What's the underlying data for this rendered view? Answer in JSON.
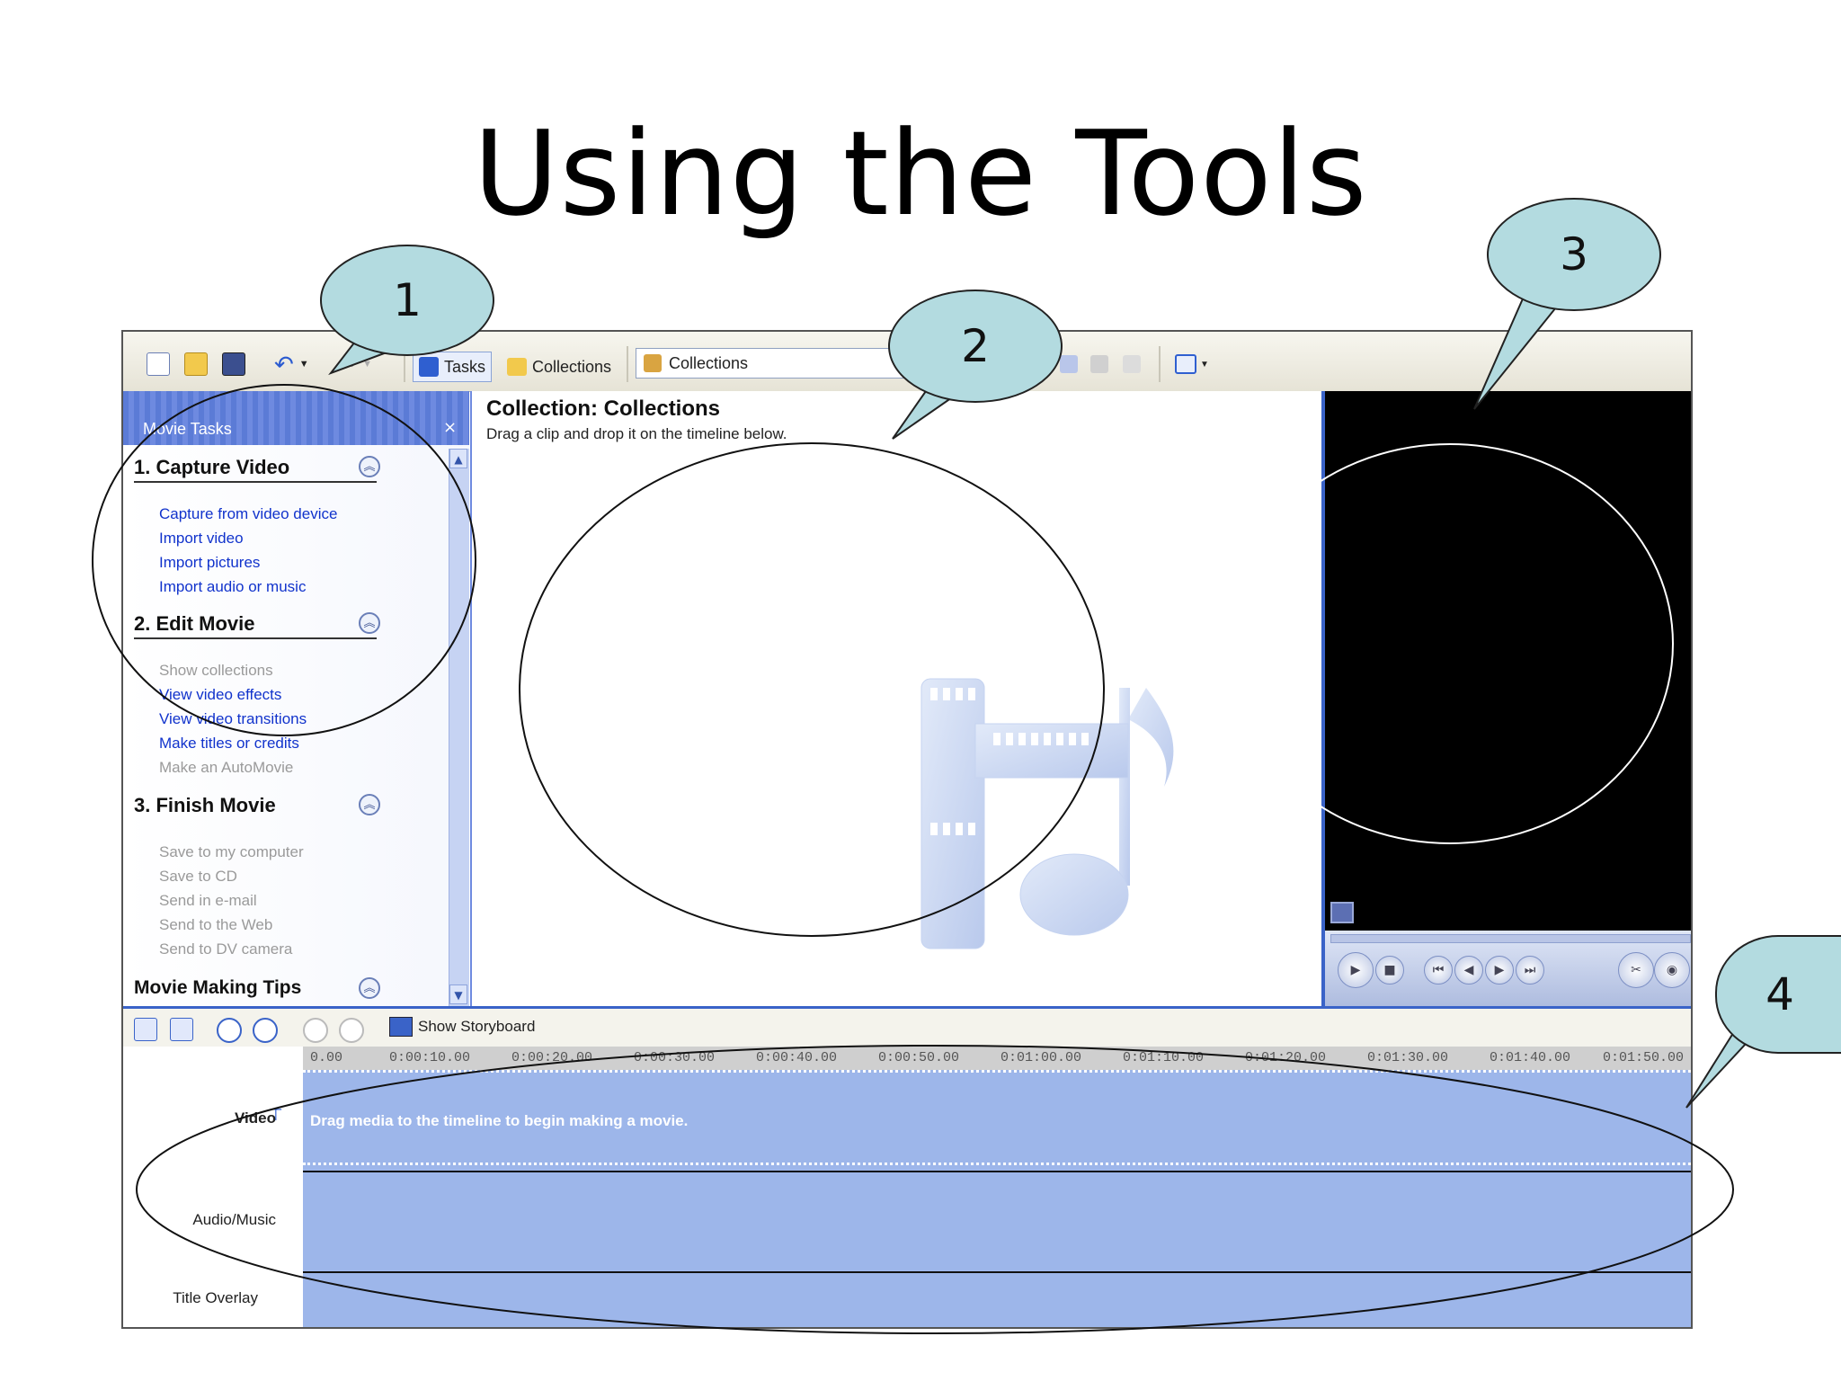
{
  "slide": {
    "title": "Using the Tools"
  },
  "toolbar": {
    "tasks_label": "Tasks",
    "collections_label": "Collections",
    "collections_combo_value": "Collections"
  },
  "task_pane": {
    "header": "Movie Tasks",
    "close_glyph": "×",
    "sections": [
      {
        "title": "1. Capture Video",
        "links": [
          {
            "label": "Capture from video device",
            "enabled": true
          },
          {
            "label": "Import video",
            "enabled": true
          },
          {
            "label": "Import pictures",
            "enabled": true
          },
          {
            "label": "Import audio or music",
            "enabled": true
          }
        ]
      },
      {
        "title": "2. Edit Movie",
        "links": [
          {
            "label": "Show collections",
            "enabled": false
          },
          {
            "label": "View video effects",
            "enabled": true
          },
          {
            "label": "View video transitions",
            "enabled": true
          },
          {
            "label": "Make titles or credits",
            "enabled": true
          },
          {
            "label": "Make an AutoMovie",
            "enabled": false
          }
        ]
      },
      {
        "title": "3. Finish Movie",
        "links": [
          {
            "label": "Save to my computer",
            "enabled": false
          },
          {
            "label": "Save to CD",
            "enabled": false
          },
          {
            "label": "Send in e-mail",
            "enabled": false
          },
          {
            "label": "Send to the Web",
            "enabled": false
          },
          {
            "label": "Send to DV camera",
            "enabled": false
          }
        ]
      }
    ],
    "tips_title": "Movie Making Tips"
  },
  "collection": {
    "title": "Collection: Collections",
    "subtitle": "Drag a clip and drop it on the timeline below."
  },
  "timeline": {
    "storyboard_label": "Show Storyboard",
    "ruler_ticks": [
      "0.00",
      "0:00:10.00",
      "0:00:20.00",
      "0:00:30.00",
      "0:00:40.00",
      "0:00:50.00",
      "0:01:00.00",
      "0:01:10.00",
      "0:01:20.00",
      "0:01:30.00",
      "0:01:40.00",
      "0:01:50.00"
    ],
    "video_label": "Video",
    "video_msg": "Drag media to the timeline to begin making a movie.",
    "audio_label": "Audio/Music",
    "overlay_label": "Title Overlay"
  },
  "callouts": [
    "1",
    "2",
    "3",
    "4"
  ],
  "colors": {
    "callout_fill": "#b3dbe0",
    "task_header": "#6e8ae0",
    "track_fill": "#9db6ea",
    "preview_bg": "#000000"
  }
}
